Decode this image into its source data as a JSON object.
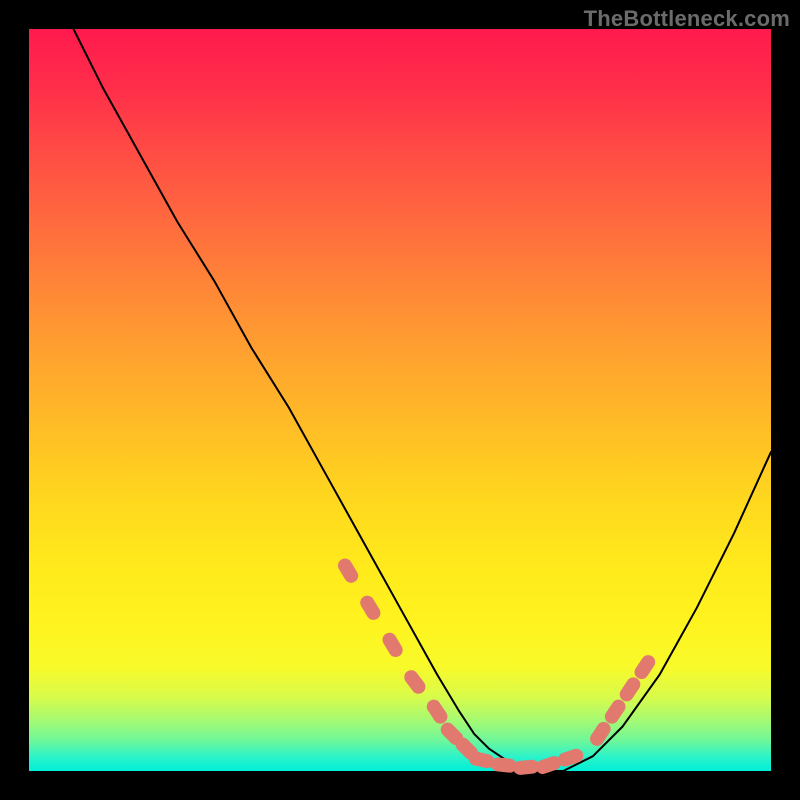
{
  "watermark": "TheBottleneck.com",
  "chart_data": {
    "type": "line",
    "title": "",
    "xlabel": "",
    "ylabel": "",
    "xlim": [
      0,
      100
    ],
    "ylim": [
      0,
      100
    ],
    "grid": false,
    "legend": false,
    "background_gradient": {
      "top": "#ff1a4d",
      "middle": "#ffd91e",
      "bottom": "#00efd8"
    },
    "series": [
      {
        "name": "bottleneck-curve",
        "color": "#000000",
        "stroke_width": 2,
        "x": [
          6,
          10,
          15,
          20,
          25,
          30,
          35,
          40,
          45,
          50,
          55,
          58,
          60,
          62,
          65,
          68,
          72,
          76,
          80,
          85,
          90,
          95,
          100
        ],
        "y": [
          100,
          92,
          83,
          74,
          66,
          57,
          49,
          40,
          31,
          22,
          13,
          8,
          5,
          3,
          1,
          0,
          0,
          2,
          6,
          13,
          22,
          32,
          43
        ]
      },
      {
        "name": "highlighted-range-left",
        "color": "#e2796f",
        "stroke_width": 10,
        "style": "dotted",
        "x": [
          43,
          46,
          49,
          52,
          55,
          57,
          59
        ],
        "y": [
          27,
          22,
          17,
          12,
          8,
          5,
          3
        ]
      },
      {
        "name": "highlighted-range-bottom",
        "color": "#e2796f",
        "stroke_width": 10,
        "style": "dotted",
        "x": [
          61,
          64,
          67,
          70,
          73
        ],
        "y": [
          1.5,
          0.8,
          0.5,
          0.8,
          1.8
        ]
      },
      {
        "name": "highlighted-range-right",
        "color": "#e2796f",
        "stroke_width": 10,
        "style": "dotted",
        "x": [
          77,
          79,
          81,
          83
        ],
        "y": [
          5,
          8,
          11,
          14
        ]
      }
    ]
  }
}
